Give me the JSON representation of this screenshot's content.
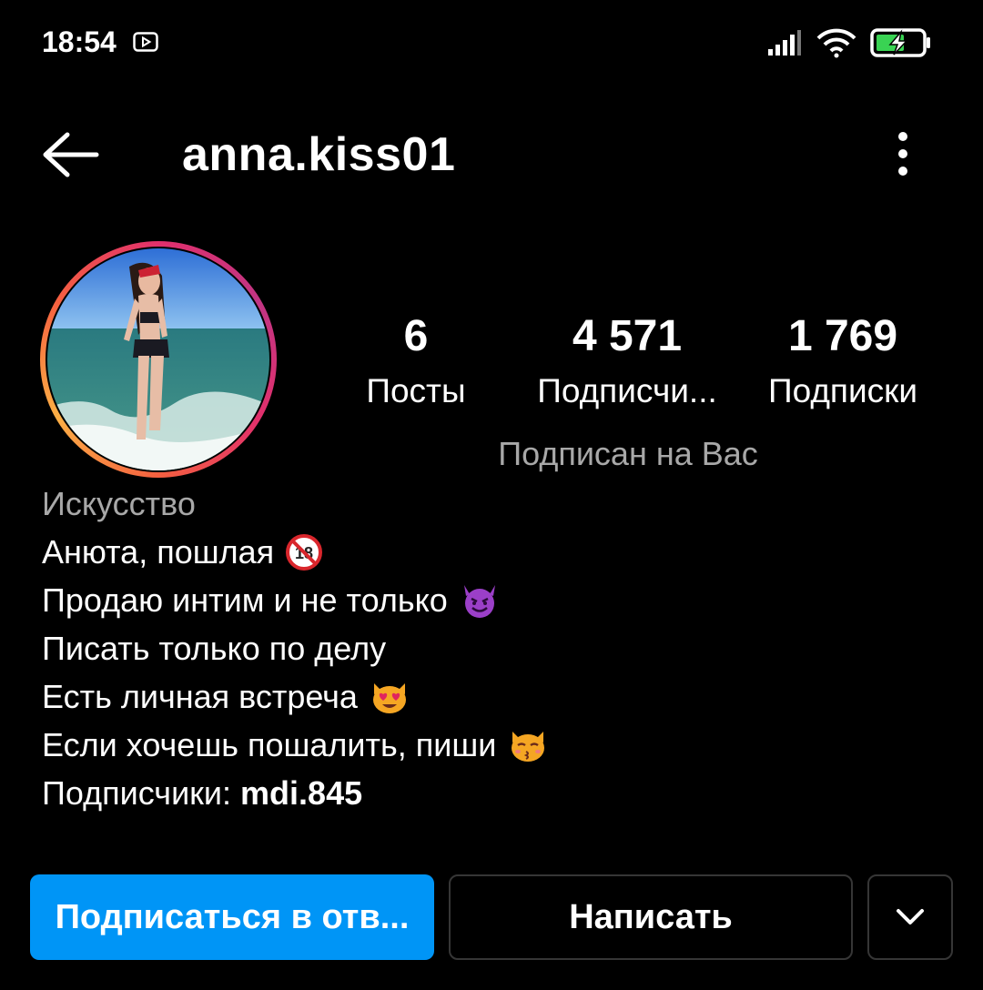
{
  "status_bar": {
    "time": "18:54",
    "icons": [
      "youtube-notification-icon",
      "signal-icon",
      "wifi-icon",
      "battery-charging-icon"
    ]
  },
  "header": {
    "username": "anna.kiss01",
    "back_icon": "back-arrow-icon",
    "more_icon": "more-vertical-icon"
  },
  "profile": {
    "stats": [
      {
        "value": "6",
        "label": "Посты"
      },
      {
        "value": "4 571",
        "label": "Подписчи..."
      },
      {
        "value": "1 769",
        "label": "Подписки"
      }
    ],
    "followed_you": "Подписан на Вас",
    "category": "Искусство",
    "bio": [
      {
        "text": "Анюта, пошлая",
        "emoji": "under-18-icon"
      },
      {
        "text": "Продаю интим и не только",
        "emoji": "smiling-devil-icon"
      },
      {
        "text": "Писать только по делу",
        "emoji": ""
      },
      {
        "text": "Есть личная встреча",
        "emoji": "heart-eyes-cat-icon"
      },
      {
        "text": "Если хочешь пошалить, пиши",
        "emoji": "kissing-cat-icon"
      }
    ],
    "followers_prefix": "Подписчики: ",
    "followers_mention": "mdi.845"
  },
  "actions": {
    "follow_back_label": "Подписаться в отв...",
    "message_label": "Написать",
    "more_icon": "chevron-down-icon"
  },
  "colors": {
    "background": "#000000",
    "primary_button": "#0095f6",
    "secondary_text": "#a8a8a8",
    "button_border": "#363636"
  }
}
